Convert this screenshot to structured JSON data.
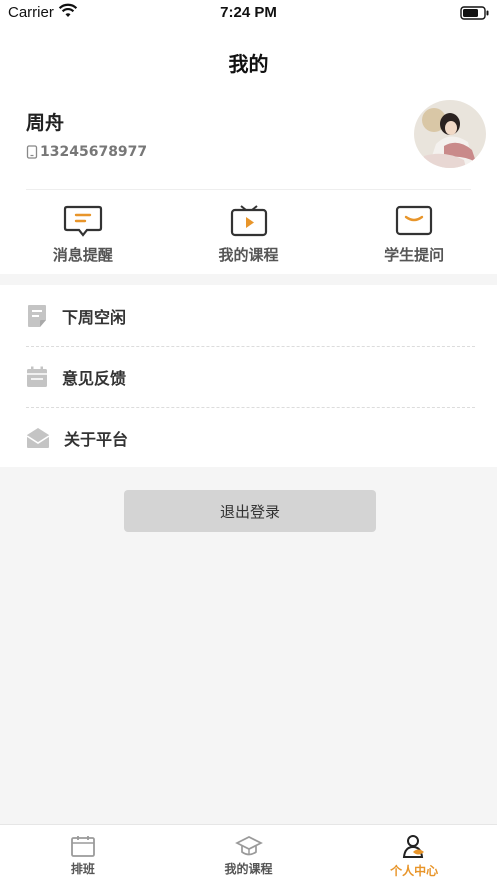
{
  "status_bar": {
    "carrier": "Carrier",
    "time": "7:24 PM"
  },
  "nav": {
    "title": "我的"
  },
  "profile": {
    "name": "周舟",
    "phone": "13245678977"
  },
  "quick_actions": [
    {
      "label": "消息提醒",
      "icon": "message-icon"
    },
    {
      "label": "我的课程",
      "icon": "video-course-icon"
    },
    {
      "label": "学生提问",
      "icon": "question-tv-icon"
    }
  ],
  "menu": [
    {
      "label": "下周空闲",
      "icon": "document-icon"
    },
    {
      "label": "意见反馈",
      "icon": "calendar-icon"
    },
    {
      "label": "关于平台",
      "icon": "mail-icon"
    }
  ],
  "logout_label": "退出登录",
  "tabs": [
    {
      "label": "排班",
      "icon": "schedule-icon"
    },
    {
      "label": "我的课程",
      "icon": "graduation-cap-icon"
    },
    {
      "label": "个人中心",
      "icon": "person-icon"
    }
  ],
  "colors": {
    "accent": "#e8952a",
    "icon_dark": "#333333",
    "page_bg": "#f5f5f5"
  }
}
